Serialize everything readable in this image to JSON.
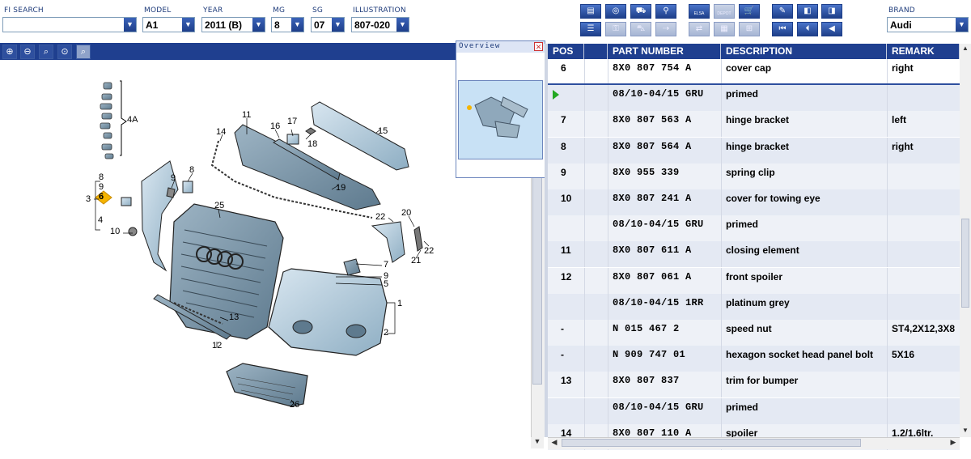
{
  "toolbar": {
    "fi_search": {
      "label": "FI SEARCH",
      "value": ""
    },
    "model": {
      "label": "MODEL",
      "value": "A1"
    },
    "year": {
      "label": "YEAR",
      "value": "2011 (B)"
    },
    "mg": {
      "label": "MG",
      "value": "8"
    },
    "sg": {
      "label": "SG",
      "value": "07"
    },
    "illustration": {
      "label": "ILLUSTRATION",
      "value": "807-020"
    },
    "brand": {
      "label": "BRAND",
      "value": "Audi"
    },
    "elsa_label": "ELSA",
    "depot_label": "DEPOT"
  },
  "overview": {
    "title": "Overview"
  },
  "diagram_callouts": [
    "4A",
    "11",
    "16",
    "17",
    "18",
    "14",
    "15",
    "8",
    "9",
    "6",
    "3",
    "4",
    "10",
    "9",
    "8",
    "25",
    "19",
    "22",
    "20",
    "21",
    "22",
    "7",
    "9",
    "5",
    "1",
    "13",
    "12",
    "2",
    "26"
  ],
  "table": {
    "columns": [
      "POS",
      "PART NUMBER",
      "DESCRIPTION",
      "REMARK"
    ],
    "rows": [
      {
        "pos": "6",
        "part": "8X0 807 754 A",
        "desc": "cover cap",
        "remark": "right",
        "selected": true
      },
      {
        "pos": "",
        "part": "08/10-04/15 GRU",
        "desc": "primed",
        "remark": "",
        "marker": true
      },
      {
        "pos": "7",
        "part": "8X0 807 563 A",
        "desc": "hinge bracket",
        "remark": "left"
      },
      {
        "pos": "8",
        "part": "8X0 807 564 A",
        "desc": "hinge bracket",
        "remark": "right"
      },
      {
        "pos": "9",
        "part": "8X0 955 339",
        "desc": "spring clip",
        "remark": ""
      },
      {
        "pos": "10",
        "part": "8X0 807 241 A",
        "desc": "cover for towing eye",
        "remark": ""
      },
      {
        "pos": "",
        "part": "08/10-04/15 GRU",
        "desc": "primed",
        "remark": ""
      },
      {
        "pos": "11",
        "part": "8X0 807 611 A",
        "desc": "closing element",
        "remark": ""
      },
      {
        "pos": "12",
        "part": "8X0 807 061 A",
        "desc": "front spoiler",
        "remark": ""
      },
      {
        "pos": "",
        "part": "08/10-04/15 1RR",
        "desc": "platinum grey",
        "remark": ""
      },
      {
        "pos": "-",
        "part": "N    015 467 2",
        "desc": "speed nut",
        "remark": "ST4,2X12,3X8"
      },
      {
        "pos": "-",
        "part": "N    909 747 01",
        "desc": "hexagon socket head panel bolt",
        "remark": "5X16"
      },
      {
        "pos": "13",
        "part": "8X0 807 837",
        "desc": "trim for bumper",
        "remark": ""
      },
      {
        "pos": "",
        "part": "08/10-04/15 GRU",
        "desc": "primed",
        "remark": ""
      },
      {
        "pos": "14",
        "part": "8X0 807 110 A",
        "desc": "spoiler",
        "remark": "1.2/1.6ltr."
      }
    ]
  },
  "colors": {
    "header": "#1f3f8f",
    "row_a": "#eef1f7",
    "row_b": "#e2e7f1",
    "accent": "#f5b400"
  }
}
